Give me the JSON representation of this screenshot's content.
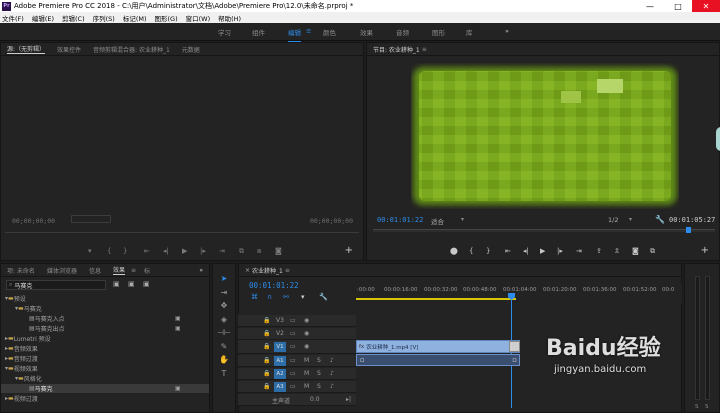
{
  "window": {
    "title": "Adobe Premiere Pro CC 2018 - C:\\用户\\Administrator\\文档\\Adobe\\Premiere Pro\\12.0\\未命名.prproj *",
    "app_icon_label": "Pr",
    "minimize": "—",
    "maximize": "□",
    "close": "✕"
  },
  "menu": [
    "文件(F)",
    "编辑(E)",
    "剪辑(C)",
    "序列(S)",
    "标记(M)",
    "图形(G)",
    "窗口(W)",
    "帮助(H)"
  ],
  "workspaces": {
    "items": [
      "学习",
      "组件",
      "编辑",
      "颜色",
      "效果",
      "音频",
      "图形",
      "库"
    ],
    "active_index": 2,
    "more": "»"
  },
  "source_panel": {
    "tabs": [
      "源:（无剪辑）",
      "效果控件",
      "音频剪辑混合器: 农业耕种_1",
      "元数据"
    ],
    "timecode_left": "00;00;00;00",
    "timecode_right": "00;00;00;00",
    "add": "+"
  },
  "program_panel": {
    "tab": "节目: 农业耕种_1",
    "menu_glyph": "≡",
    "timecode": "00:01:01:22",
    "fit": "适合",
    "resolution": "1/2",
    "duration": "00:01:05:27",
    "add": "+"
  },
  "effects_panel": {
    "tabs": [
      "项: 未命名",
      "媒体浏览器",
      "信息",
      "效果",
      "标"
    ],
    "active_tab_index": 3,
    "search_value": "马赛克",
    "more": "»",
    "tree": [
      {
        "label": "预设",
        "depth": 0,
        "icon": "folder"
      },
      {
        "label": "马赛克",
        "depth": 1,
        "icon": "folder"
      },
      {
        "label": "马赛克入点",
        "depth": 2,
        "icon": "preset"
      },
      {
        "label": "马赛克出点",
        "depth": 2,
        "icon": "preset"
      },
      {
        "label": "Lumetri 预设",
        "depth": 0,
        "icon": "folder"
      },
      {
        "label": "音频效果",
        "depth": 0,
        "icon": "folder"
      },
      {
        "label": "音频过渡",
        "depth": 0,
        "icon": "folder"
      },
      {
        "label": "视频效果",
        "depth": 0,
        "icon": "folder"
      },
      {
        "label": "风格化",
        "depth": 1,
        "icon": "folder"
      },
      {
        "label": "马赛克",
        "depth": 2,
        "icon": "effect"
      },
      {
        "label": "视频过渡",
        "depth": 0,
        "icon": "folder"
      }
    ]
  },
  "timeline": {
    "tab": "农业耕种_1",
    "close": "×",
    "menu_glyph": "≡",
    "timecode": "00:01:01:22",
    "ruler": [
      ":00:00",
      "00:00:16:00",
      "00:00:32:00",
      "00:00:48:00",
      "00:01:04:00",
      "00:01:20:00",
      "00:01:36:00",
      "00:01:52:00",
      "00:0"
    ],
    "video_tracks": [
      "V3",
      "V2",
      "V1"
    ],
    "audio_tracks": [
      "A1",
      "A2",
      "A3"
    ],
    "track_controls": {
      "lock": "🔒",
      "sync": "▭",
      "eye": "👁",
      "mute": "M",
      "solo": "S",
      "mic": "🎤"
    },
    "master": {
      "label": "主声道",
      "value": "0.0"
    },
    "clip_video": "农业耕种_1.mp4 [V]",
    "clip_fx": "fx"
  },
  "meters": {
    "s1": "S",
    "s2": "S"
  },
  "watermark": {
    "brand": "Baidu经验",
    "url": "jingyan.baidu.com"
  }
}
